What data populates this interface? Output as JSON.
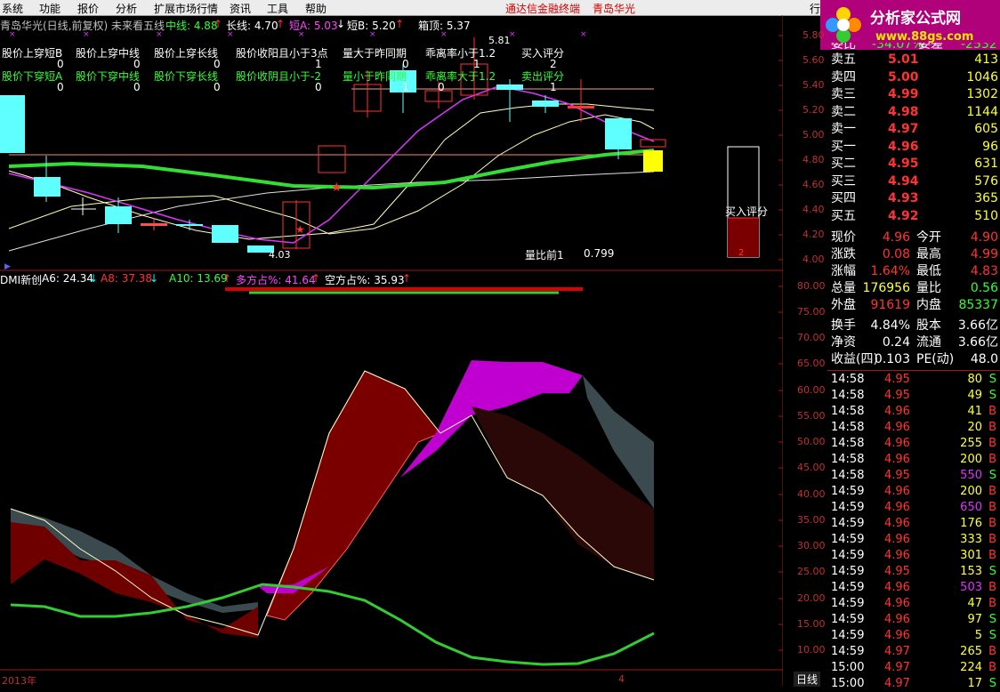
{
  "menubar": {
    "items": [
      "系统",
      "功能",
      "报价",
      "分析",
      "扩展市场行情",
      "资讯",
      "工具",
      "帮助"
    ],
    "center_title": "通达信金融终端",
    "center_stock": "青岛华光",
    "right_cut": "行"
  },
  "logo": {
    "text": "分析家公式网",
    "url": "www.88gs.com"
  },
  "main_header": {
    "title": "青岛华光(日线,前复权) 未来看五线",
    "mid_label": "中线: 4.88",
    "long_label": "长线: 4.70",
    "shortA_label": "短A: 5.03",
    "shortB_label": "短B: 5.20",
    "top_label": "箱顶: 5.37"
  },
  "signal_labels": {
    "row1": [
      "股价上穿短B",
      "股价上穿中线",
      "股价上穿长线",
      "股价收阳且小于3点",
      "量大于昨同期",
      "乖离率小于1.2",
      "买入评分"
    ],
    "row1_vals": [
      "0",
      "0",
      "0",
      "1",
      "0",
      "1",
      "2"
    ],
    "row2": [
      "股价下穿短A",
      "股价下穿中线",
      "股价下穿长线",
      "股价收阴且小于-2",
      "量小于昨同期",
      "乖离率大于1.2",
      "卖出评分"
    ],
    "row2_vals": [
      "0",
      "0",
      "0",
      "0",
      "1",
      "0",
      "1"
    ]
  },
  "main_chart_annotations": {
    "high_marker": "5.81",
    "low_marker": "4.03",
    "vol_ratio_label": "量比前1",
    "vol_ratio_value": "0.799",
    "buy_score_label": "买入评分",
    "buy_score_value": "2"
  },
  "main_axis": [
    "5.80",
    "5.60",
    "5.40",
    "5.20",
    "5.00",
    "4.80",
    "4.60",
    "4.40",
    "4.20",
    "4.00"
  ],
  "dmi_header": {
    "name": "DMI新创",
    "a6": "A6: 24.34",
    "a8": "A8: 37.38",
    "a10": "A10: 13.69",
    "long_pct": "多方占%: 41.64",
    "short_pct": "空方占%: 35.93"
  },
  "dmi_axis": [
    "80.00",
    "75.00",
    "70.00",
    "65.00",
    "60.00",
    "55.00",
    "50.00",
    "45.00",
    "40.00",
    "35.00",
    "30.00",
    "25.00",
    "20.00",
    "15.00",
    "10.00"
  ],
  "bottom": {
    "year": "2013年",
    "month_mark": "4",
    "period_button": "日线"
  },
  "quote_top_cut": {
    "l1": "委比",
    "v1": "-34.07%",
    "l2": "委差",
    "v2": "-2532"
  },
  "order_book": [
    {
      "label": "卖五",
      "price": "5.01",
      "vol": "413"
    },
    {
      "label": "卖四",
      "price": "5.00",
      "vol": "1046"
    },
    {
      "label": "卖三",
      "price": "4.99",
      "vol": "1302"
    },
    {
      "label": "卖二",
      "price": "4.98",
      "vol": "1144"
    },
    {
      "label": "卖一",
      "price": "4.97",
      "vol": "605"
    },
    {
      "label": "买一",
      "price": "4.96",
      "vol": "96"
    },
    {
      "label": "买二",
      "price": "4.95",
      "vol": "631"
    },
    {
      "label": "买三",
      "price": "4.94",
      "vol": "576"
    },
    {
      "label": "买四",
      "price": "4.93",
      "vol": "365"
    },
    {
      "label": "买五",
      "price": "4.92",
      "vol": "510"
    }
  ],
  "quote_stats": [
    {
      "l1": "现价",
      "v1": "4.96",
      "l2": "今开",
      "v2": "4.90"
    },
    {
      "l1": "涨跌",
      "v1": "0.08",
      "l2": "最高",
      "v2": "4.99"
    },
    {
      "l1": "涨幅",
      "v1": "1.64%",
      "l2": "最低",
      "v2": "4.83"
    },
    {
      "l1": "总量",
      "v1": "176956",
      "l2": "量比",
      "v2": "0.56"
    },
    {
      "l1": "外盘",
      "v1": "91619",
      "l2": "内盘",
      "v2": "85337"
    }
  ],
  "fundamentals": [
    {
      "l1": "换手",
      "v1": "4.84%",
      "l2": "股本",
      "v2": "3.66亿"
    },
    {
      "l1": "净资",
      "v1": "0.24",
      "l2": "流通",
      "v2": "3.66亿"
    },
    {
      "l1": "收益(四)",
      "v1": "0.103",
      "l2": "PE(动)",
      "v2": "48.0"
    }
  ],
  "ticks": [
    {
      "t": "14:58",
      "p": "4.95",
      "v": "80",
      "s": "S"
    },
    {
      "t": "14:58",
      "p": "4.95",
      "v": "49",
      "s": "S"
    },
    {
      "t": "14:58",
      "p": "4.96",
      "v": "41",
      "s": "B"
    },
    {
      "t": "14:58",
      "p": "4.96",
      "v": "20",
      "s": "B"
    },
    {
      "t": "14:58",
      "p": "4.96",
      "v": "255",
      "s": "B"
    },
    {
      "t": "14:58",
      "p": "4.96",
      "v": "200",
      "s": "B"
    },
    {
      "t": "14:58",
      "p": "4.95",
      "v": "550",
      "s": "S"
    },
    {
      "t": "14:59",
      "p": "4.96",
      "v": "200",
      "s": "B"
    },
    {
      "t": "14:59",
      "p": "4.96",
      "v": "650",
      "s": "B"
    },
    {
      "t": "14:59",
      "p": "4.96",
      "v": "176",
      "s": "B"
    },
    {
      "t": "14:59",
      "p": "4.96",
      "v": "333",
      "s": "B"
    },
    {
      "t": "14:59",
      "p": "4.96",
      "v": "301",
      "s": "B"
    },
    {
      "t": "14:59",
      "p": "4.95",
      "v": "153",
      "s": "S"
    },
    {
      "t": "14:59",
      "p": "4.96",
      "v": "503",
      "s": "B"
    },
    {
      "t": "14:59",
      "p": "4.96",
      "v": "47",
      "s": "B"
    },
    {
      "t": "14:59",
      "p": "4.96",
      "v": "97",
      "s": "S"
    },
    {
      "t": "14:59",
      "p": "4.96",
      "v": "5",
      "s": "S"
    },
    {
      "t": "14:59",
      "p": "4.97",
      "v": "265",
      "s": "B"
    },
    {
      "t": "15:00",
      "p": "4.97",
      "v": "224",
      "s": "B"
    },
    {
      "t": "15:00",
      "p": "4.97",
      "v": "17",
      "s": "S"
    }
  ],
  "colors": {
    "up": "#ff3333",
    "down": "#00ffff",
    "buy": "#ff3333",
    "sell": "#33ff33",
    "accent": "#b0007a"
  }
}
